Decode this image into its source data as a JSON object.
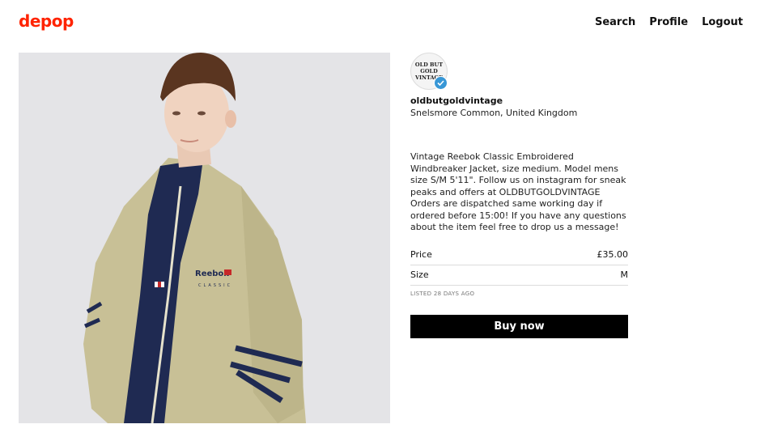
{
  "header": {
    "logo": "depop",
    "nav": [
      {
        "label": "Search"
      },
      {
        "label": "Profile"
      },
      {
        "label": "Logout"
      }
    ]
  },
  "product": {
    "image_alt": "Model wearing vintage Reebok Classic windbreaker jacket",
    "jacket_brand_text": "Reebok",
    "jacket_brand_sub": "CLASSIC"
  },
  "seller": {
    "avatar_text": "OLD BUT GOLD VINTAGE",
    "username": "oldbutgoldvintage",
    "location": "Snelsmore Common, United Kingdom",
    "verified": true
  },
  "listing": {
    "description": "Vintage Reebok Classic Embroidered Windbreaker Jacket, size medium. Model mens size S/M 5'11\". Follow us on instagram for sneak peaks and offers at OLDBUTGOLDVINTAGE Orders are dispatched same working day if ordered before 15:00! If you have any questions about the item feel free to drop us a message!",
    "attributes": [
      {
        "label": "Price",
        "value": "£35.00"
      },
      {
        "label": "Size",
        "value": "M"
      }
    ],
    "listed": "LISTED 28 DAYS AGO",
    "buy_label": "Buy now"
  },
  "colors": {
    "brand": "#ff2300",
    "verified_badge": "#3897d6",
    "button_bg": "#000000"
  }
}
